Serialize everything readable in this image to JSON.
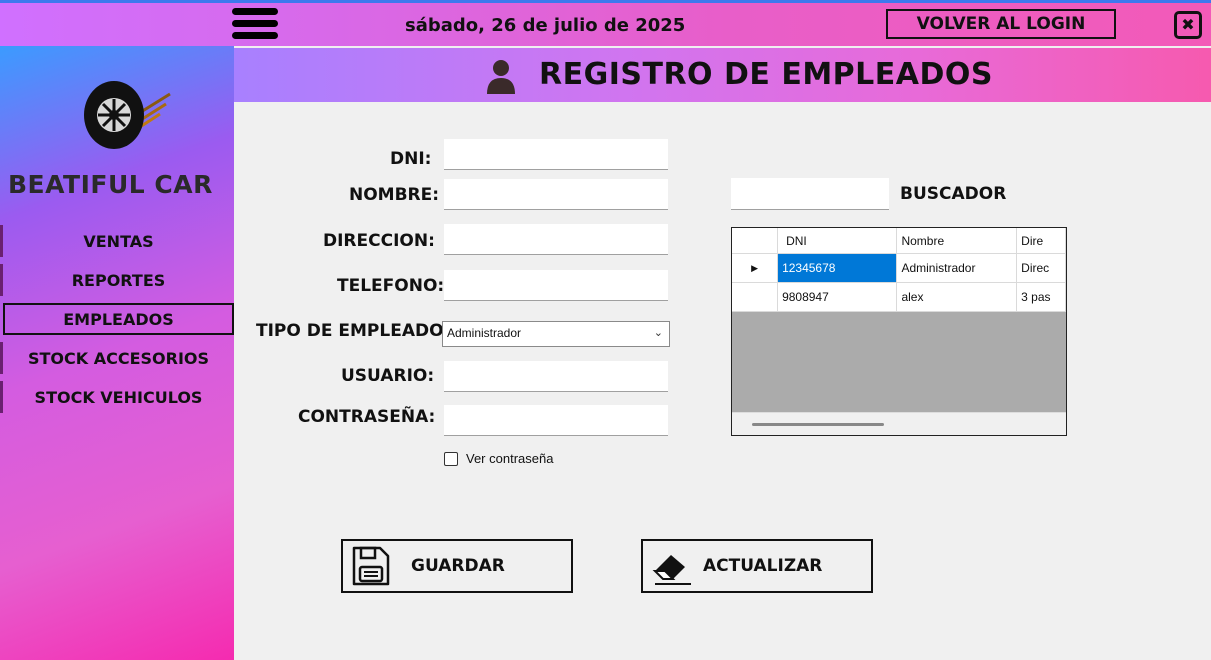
{
  "topbar": {
    "date": "sábado, 26 de julio de 2025",
    "login_button": "VOLVER AL LOGIN",
    "close_glyph": "✖"
  },
  "sidebar": {
    "brand": "BEATIFUL CAR",
    "items": [
      {
        "label": "VENTAS",
        "active": false
      },
      {
        "label": "REPORTES",
        "active": false
      },
      {
        "label": "EMPLEADOS",
        "active": true
      },
      {
        "label": "STOCK ACCESORIOS",
        "active": false
      },
      {
        "label": "STOCK VEHICULOS",
        "active": false
      }
    ]
  },
  "header": {
    "title": "REGISTRO DE EMPLEADOS"
  },
  "form": {
    "dni_label": "DNI:",
    "nombre_label": "NOMBRE:",
    "direccion_label": "DIRECCION:",
    "telefono_label": "TELEFONO:",
    "tipo_label": "TIPO DE EMPLEADO:",
    "tipo_value": "Administrador",
    "usuario_label": "USUARIO:",
    "contrasena_label": "CONTRASEÑA:",
    "ver_contrasena": "Ver contraseña",
    "ver_contrasena_checked": false
  },
  "search": {
    "label": "BUSCADOR",
    "value": ""
  },
  "grid": {
    "columns": [
      "DNI",
      "Nombre",
      "Dire"
    ],
    "rows": [
      {
        "cells": [
          "12345678",
          "Administrador",
          "Direc"
        ],
        "current": true
      },
      {
        "cells": [
          "9808947",
          "alex",
          "3 pas"
        ],
        "current": false
      }
    ]
  },
  "actions": {
    "save": "GUARDAR",
    "update": "ACTUALIZAR"
  },
  "colors": {
    "selection": "#0078d7",
    "accent_pink": "#f52bb0",
    "accent_purple": "#d070ff"
  }
}
